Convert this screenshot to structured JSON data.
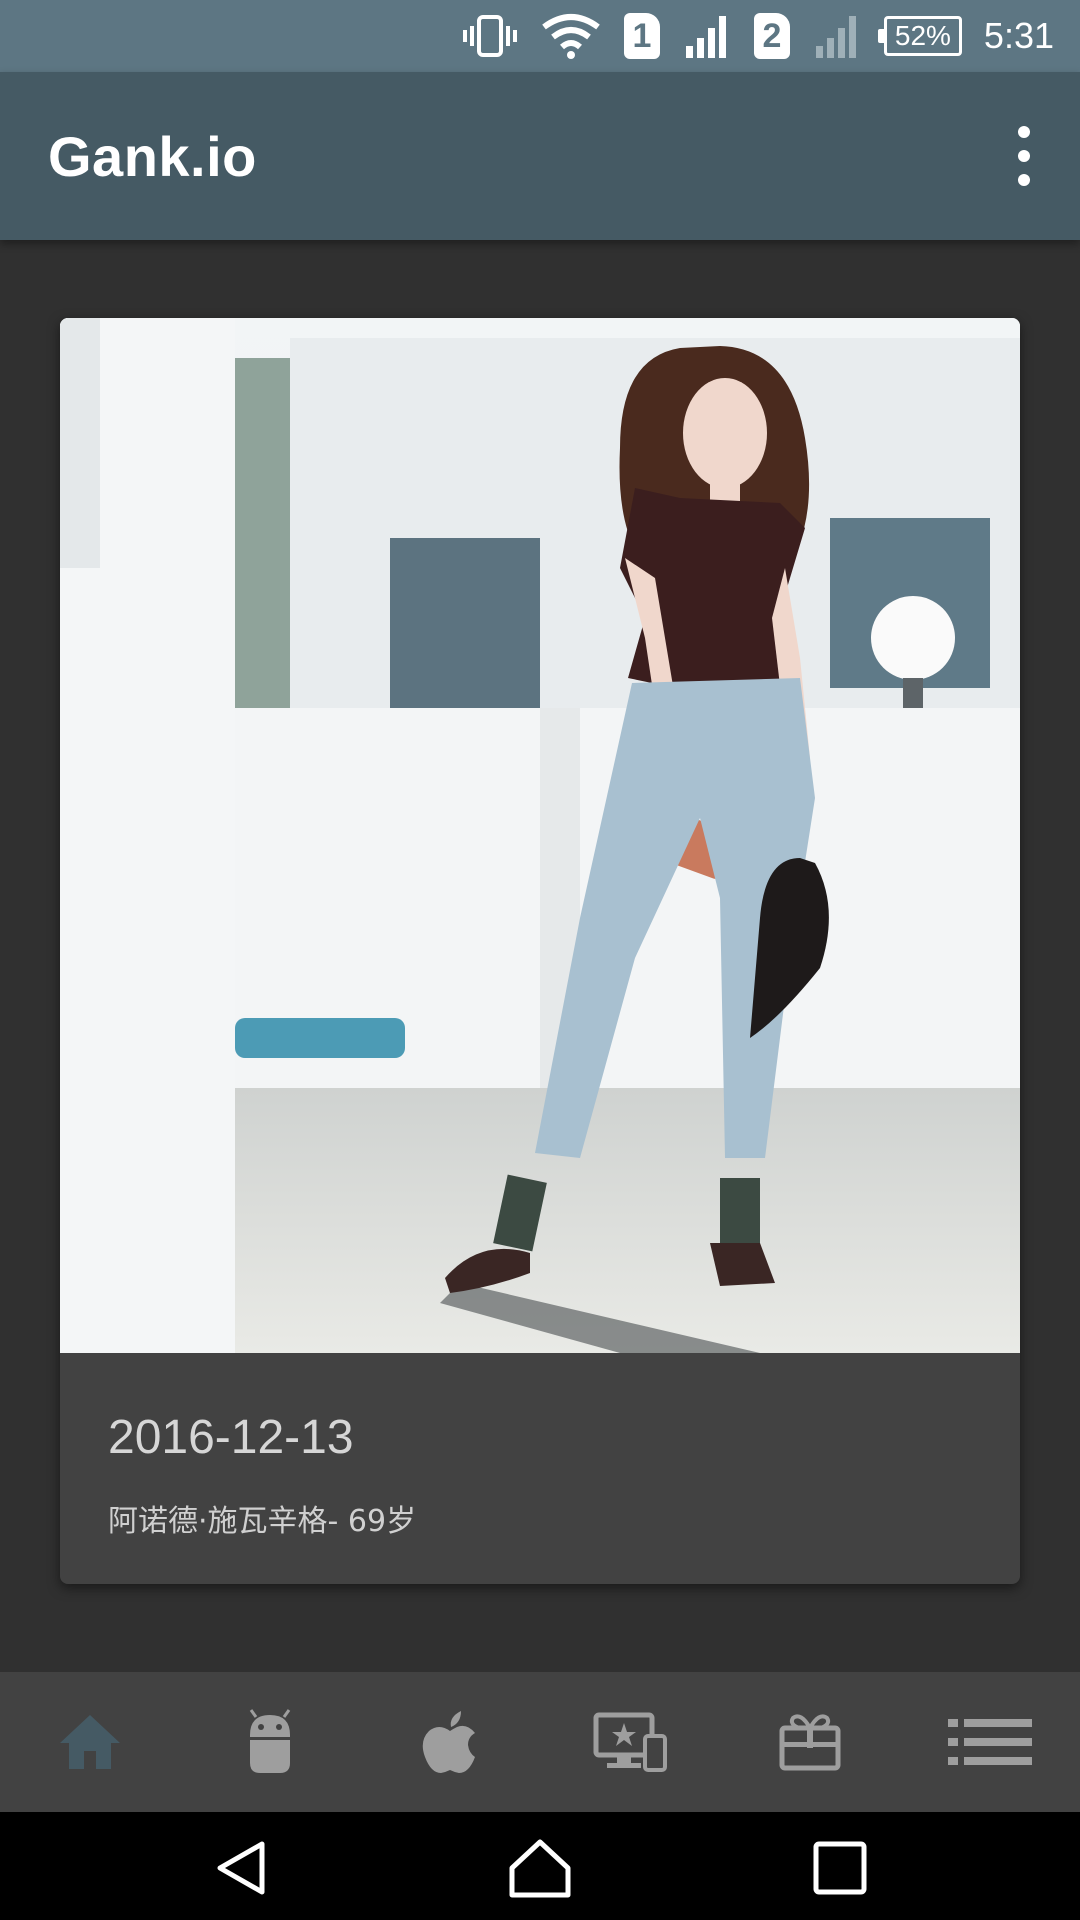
{
  "status_bar": {
    "sim1": "1",
    "sim2": "2",
    "battery": "52%",
    "time": "5:31",
    "icons": [
      "vibrate-icon",
      "wifi-icon",
      "signal-icon",
      "signal-weak-icon",
      "battery-icon"
    ]
  },
  "toolbar": {
    "title": "Gank.io",
    "overflow_icon": "more-vert-icon"
  },
  "card": {
    "date": "2016-12-13",
    "description": "阿诺德·施瓦辛格- 69岁"
  },
  "bottom_nav": {
    "active_index": 0,
    "active_color": "#455a64",
    "inactive_color": "#9e9e9e",
    "items": [
      "home-icon",
      "android-icon",
      "apple-icon",
      "desktop-star-icon",
      "gift-icon",
      "list-icon"
    ]
  },
  "colors": {
    "status_bar": "#5d7683",
    "toolbar": "#455a64",
    "background": "#303030",
    "card": "#424242"
  }
}
